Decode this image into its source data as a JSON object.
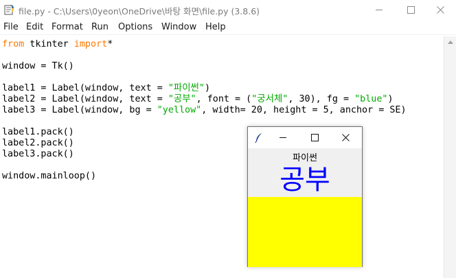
{
  "window": {
    "title": "file.py - C:\\Users\\0yeon\\OneDrive\\바탕 화면\\file.py (3.8.6)",
    "min_symbol": "—",
    "max_symbol": "☐",
    "close_symbol": "✕"
  },
  "menu": [
    "File",
    "Edit",
    "Format",
    "Run",
    "Options",
    "Window",
    "Help"
  ],
  "code_lines": [
    [
      {
        "t": "from",
        "c": "kw"
      },
      {
        "t": " tkinter ",
        "c": ""
      },
      {
        "t": "import",
        "c": "kw"
      },
      {
        "t": "*",
        "c": ""
      }
    ],
    [],
    [
      {
        "t": "window = Tk()",
        "c": ""
      }
    ],
    [],
    [
      {
        "t": "label1 = Label(window, text = ",
        "c": ""
      },
      {
        "t": "\"파이썬\"",
        "c": "str"
      },
      {
        "t": ")",
        "c": ""
      }
    ],
    [
      {
        "t": "label2 = Label(window, text = ",
        "c": ""
      },
      {
        "t": "\"공부\"",
        "c": "str"
      },
      {
        "t": ", font = (",
        "c": ""
      },
      {
        "t": "\"궁서체\"",
        "c": "str"
      },
      {
        "t": ", 30), fg = ",
        "c": ""
      },
      {
        "t": "\"blue\"",
        "c": "str"
      },
      {
        "t": ")",
        "c": ""
      }
    ],
    [
      {
        "t": "label3 = Label(window, bg = ",
        "c": ""
      },
      {
        "t": "\"yellow\"",
        "c": "str"
      },
      {
        "t": ", width= 20, height = 5, anchor = SE)",
        "c": ""
      }
    ],
    [],
    [
      {
        "t": "label1.pack()",
        "c": ""
      }
    ],
    [
      {
        "t": "label2.pack()",
        "c": ""
      }
    ],
    [
      {
        "t": "label3.pack()",
        "c": ""
      }
    ],
    [],
    [
      {
        "t": "window.mainloop()",
        "c": ""
      }
    ]
  ],
  "tk_window": {
    "min_symbol": "—",
    "max_symbol": "☐",
    "close_symbol": "✕",
    "label1": "파이썬",
    "label2": "공부",
    "label2_color": "#0000ff",
    "label3_bg": "#ffff00"
  },
  "colors": {
    "keyword": "#ff7700",
    "string": "#00aa00"
  }
}
